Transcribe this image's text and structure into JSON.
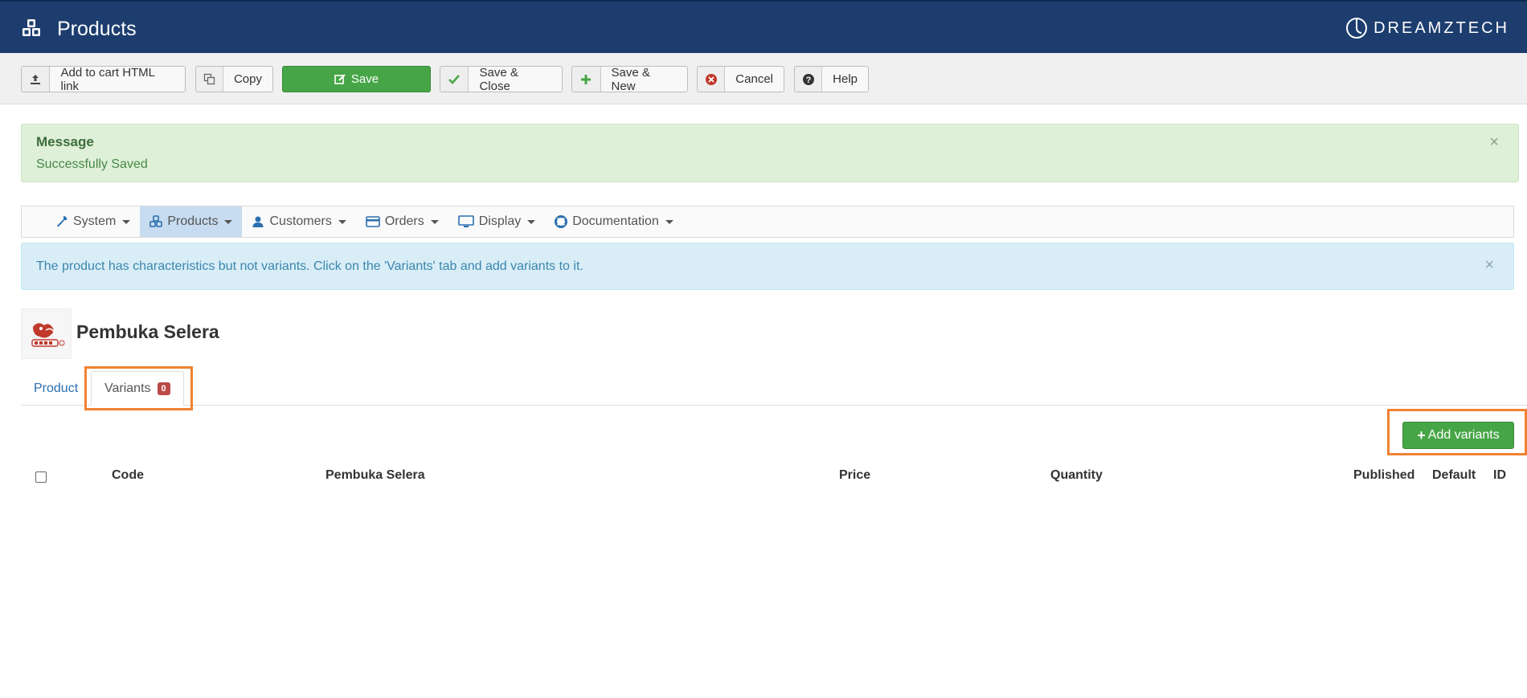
{
  "header": {
    "title": "Products",
    "brand": "DREAMZTECH",
    "icon": "cubes-icon",
    "color": "#1c3d6e"
  },
  "toolbar": {
    "add_to_cart_label": "Add to cart HTML link",
    "copy_label": "Copy",
    "save_label": "Save",
    "save_close_label": "Save & Close",
    "save_new_label": "Save & New",
    "cancel_label": "Cancel",
    "help_label": "Help"
  },
  "message": {
    "heading": "Message",
    "body": "Successfully Saved",
    "close": "×"
  },
  "nav": {
    "items": [
      {
        "label": "System",
        "icon": "wrench-icon",
        "active": false
      },
      {
        "label": "Products",
        "icon": "cubes-icon",
        "active": true
      },
      {
        "label": "Customers",
        "icon": "user-icon",
        "active": false
      },
      {
        "label": "Orders",
        "icon": "credit-card-icon",
        "active": false
      },
      {
        "label": "Display",
        "icon": "monitor-icon",
        "active": false
      },
      {
        "label": "Documentation",
        "icon": "lifebuoy-icon",
        "active": false
      }
    ]
  },
  "info": {
    "text": "The product has characteristics but not variants. Click on the 'Variants' tab and add variants to it.",
    "close": "×"
  },
  "product": {
    "name": "Pembuka Selera"
  },
  "tabs": {
    "product_label": "Product",
    "variants_label": "Variants",
    "variants_count": "0"
  },
  "add_variants_label": "Add variants",
  "table": {
    "headers": {
      "code": "Code",
      "name": "Pembuka Selera",
      "price": "Price",
      "quantity": "Quantity",
      "published": "Published",
      "default": "Default",
      "id": "ID"
    }
  },
  "colors": {
    "highlight": "#f08232",
    "success": "#46a546",
    "info_bg": "#d9edf7",
    "message_bg": "#dff0d8"
  }
}
